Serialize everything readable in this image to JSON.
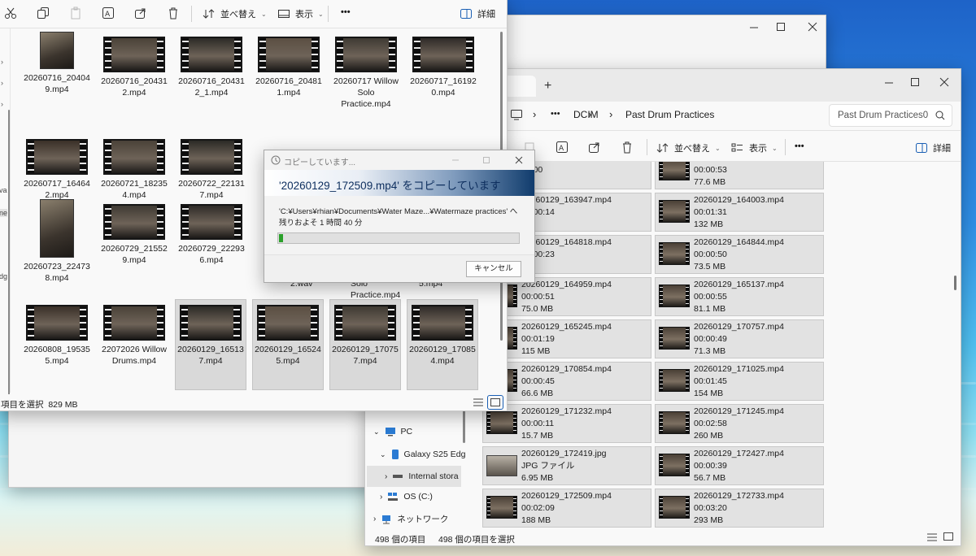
{
  "colors": {
    "accent": "#1a5fb4",
    "progress": "#2aa02a",
    "dialog_header": "#0e3a6b"
  },
  "back_window": {
    "controls": [
      "minimize-icon",
      "maximize-icon",
      "close-icon"
    ]
  },
  "left_explorer": {
    "toolbar": {
      "sort_label": "並べ替え",
      "view_label": "表示",
      "more_label": "•••",
      "details_label": "詳細"
    },
    "items": [
      {
        "name": "20260716_204049.mp4",
        "lines": [
          "20260716_20404",
          "9.mp4"
        ],
        "selected": false
      },
      {
        "name": "20260716_204312.mp4",
        "lines": [
          "20260716_20431",
          "2.mp4"
        ],
        "selected": false
      },
      {
        "name": "20260716_204312_1.mp4",
        "lines": [
          "20260716_20431",
          "2_1.mp4"
        ],
        "selected": false
      },
      {
        "name": "20260716_204811.mp4",
        "lines": [
          "20260716_20481",
          "1.mp4"
        ],
        "selected": false
      },
      {
        "name": "20260717 Willow Solo Practice.mp4",
        "lines": [
          "20260717 Willow",
          "Solo",
          "Practice.mp4"
        ],
        "selected": false
      },
      {
        "name": "20260717_161920.mp4",
        "lines": [
          "20260717_16192",
          "0.mp4"
        ],
        "selected": false
      },
      {
        "name": "20260717_164642.mp4",
        "lines": [
          "20260717_16464",
          "2.mp4"
        ],
        "selected": false
      },
      {
        "name": "20260721_182354.mp4",
        "lines": [
          "20260721_18235",
          "4.mp4"
        ],
        "selected": false
      },
      {
        "name": "20260722_221317.mp4",
        "lines": [
          "20260722_22131",
          "7.mp4"
        ],
        "selected": false
      },
      {
        "name": "20260723_224738.mp4",
        "lines": [
          "20260723_22473",
          "8.mp4"
        ],
        "selected": false
      },
      {
        "name": "20260729_215529.mp4",
        "lines": [
          "20260729_21552",
          "9.mp4"
        ],
        "selected": false
      },
      {
        "name": "20260729_222936.mp4",
        "lines": [
          "20260729_22293",
          "6.mp4"
        ],
        "selected": false
      },
      {
        "name": "20260808_195355.mp4",
        "lines": [
          "20260808_19535",
          "5.mp4"
        ],
        "selected": false
      },
      {
        "name": "22072026 Willow Drums.mp4",
        "lines": [
          "22072026 Willow",
          "Drums.mp4"
        ],
        "selected": false
      },
      {
        "name": "20260129_165137.mp4",
        "lines": [
          "20260129_16513",
          "7.mp4"
        ],
        "selected": true
      },
      {
        "name": "20260129_165245.mp4",
        "lines": [
          "20260129_16524",
          "5.mp4"
        ],
        "selected": true
      },
      {
        "name": "20260129_170757.mp4",
        "lines": [
          "20260129_17075",
          "7.mp4"
        ],
        "selected": true
      },
      {
        "name": "20260129_170854.mp4",
        "lines": [
          "20260129_17085",
          "4.mp4"
        ],
        "selected": true
      }
    ],
    "hidden_fragments": [
      "2.wav",
      "Solo",
      "Practice.mp4",
      "5.mp4"
    ],
    "left_edge_fragments": [
      "va",
      "ne",
      "dg"
    ],
    "status": "項目を選択  829 MB"
  },
  "right_explorer": {
    "new_tab_label": "+",
    "breadcrumb": [
      "•••",
      "DCIM",
      "Past Drum Practices"
    ],
    "search_placeholder": "Past Drum Practices0",
    "toolbar": {
      "sort_label": "並べ替え",
      "view_label": "表示",
      "more_label": "•••",
      "details_label": "詳細"
    },
    "files": [
      {
        "name": "",
        "line2": "01:00",
        "line3": "MB",
        "partial": true
      },
      {
        "name": "",
        "line2": "00:00:53",
        "line3": "77.6 MB",
        "partial": true
      },
      {
        "name": "20260129_163947.mp4",
        "line2": "00:00:14",
        "line3": "MB"
      },
      {
        "name": "20260129_164003.mp4",
        "line2": "00:01:31",
        "line3": "132 MB"
      },
      {
        "name": "20260129_164818.mp4",
        "line2": "00:00:23",
        "line3": "MB"
      },
      {
        "name": "20260129_164844.mp4",
        "line2": "00:00:50",
        "line3": "73.5 MB"
      },
      {
        "name": "20260129_164959.mp4",
        "line2": "00:00:51",
        "line3": "75.0 MB"
      },
      {
        "name": "20260129_165137.mp4",
        "line2": "00:00:55",
        "line3": "81.1 MB"
      },
      {
        "name": "20260129_165245.mp4",
        "line2": "00:01:19",
        "line3": "115 MB"
      },
      {
        "name": "20260129_170757.mp4",
        "line2": "00:00:49",
        "line3": "71.3 MB"
      },
      {
        "name": "20260129_170854.mp4",
        "line2": "00:00:45",
        "line3": "66.6 MB"
      },
      {
        "name": "20260129_171025.mp4",
        "line2": "00:01:45",
        "line3": "154 MB"
      },
      {
        "name": "20260129_171232.mp4",
        "line2": "00:00:11",
        "line3": "15.7 MB"
      },
      {
        "name": "20260129_171245.mp4",
        "line2": "00:02:58",
        "line3": "260 MB"
      },
      {
        "name": "20260129_172419.jpg",
        "line2": "JPG ファイル",
        "line3": "6.95 MB",
        "is_image": true
      },
      {
        "name": "20260129_172427.mp4",
        "line2": "00:00:39",
        "line3": "56.7 MB"
      },
      {
        "name": "20260129_172509.mp4",
        "line2": "00:02:09",
        "line3": "188 MB"
      },
      {
        "name": "20260129_172733.mp4",
        "line2": "00:03:20",
        "line3": "293 MB"
      }
    ],
    "nav": {
      "pc": "PC",
      "galaxy": "Galaxy S25 Edg",
      "internal": "Internal stora",
      "os": "OS (C:)",
      "network": "ネットワーク"
    },
    "status_count": "498 個の項目",
    "status_selected": "498 個の項目を選択"
  },
  "copy_dialog": {
    "title": "コピーしています...",
    "header": "'20260129_172509.mp4' をコピーしています",
    "path": "'C:¥Users¥rhian¥Documents¥Water Maze...¥Watermaze practices' へ",
    "remaining": "残りおよそ 1 時間 40 分",
    "progress": 0.018,
    "cancel_label": "キャンセル"
  }
}
